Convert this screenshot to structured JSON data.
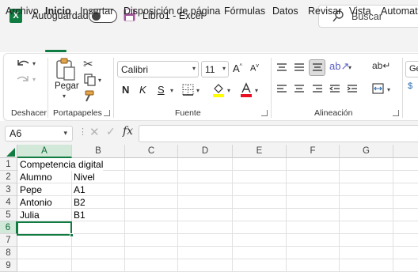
{
  "titlebar": {
    "logo": "X",
    "autosave_label": "Autoguardado",
    "doc_title": "Libro1  -  Excel",
    "search_placeholder": "Buscar"
  },
  "tabs": [
    {
      "label": "Archivo",
      "active": false
    },
    {
      "label": "Inicio",
      "active": true
    },
    {
      "label": "Insertar",
      "active": false
    },
    {
      "label": "Disposición de página",
      "active": false
    },
    {
      "label": "Fórmulas",
      "active": false
    },
    {
      "label": "Datos",
      "active": false
    },
    {
      "label": "Revisar",
      "active": false
    },
    {
      "label": "Vista",
      "active": false
    },
    {
      "label": "Automati",
      "active": false
    }
  ],
  "ribbon": {
    "groups": {
      "undo": "Deshacer",
      "clipboard": "Portapapeles",
      "font": "Fuente",
      "alignment": "Alineación"
    },
    "paste_label": "Pegar",
    "font_name": "Calibri",
    "font_size": "11",
    "bold": "N",
    "italic": "K",
    "underline": "S",
    "next_group_stub": "Ge"
  },
  "formula_bar": {
    "name_box": "A6",
    "fx": "fx",
    "value": ""
  },
  "sheet": {
    "columns": [
      "A",
      "B",
      "C",
      "D",
      "E",
      "F",
      "G"
    ],
    "rows": [
      "1",
      "2",
      "3",
      "4",
      "5",
      "6",
      "7",
      "8",
      "9"
    ],
    "active_cell": "A6",
    "cells": {
      "A1": "Competencia digital",
      "A2": "Alumno",
      "B2": "Nivel",
      "A3": "Pepe",
      "B3": "A1",
      "A4": "Antonio",
      "B4": "B2",
      "A5": "Julia",
      "B5": "B1"
    }
  },
  "colors": {
    "accent": "#107c41",
    "header_bg": "#f3f3f3",
    "selected_header": "#d2e8d9"
  }
}
